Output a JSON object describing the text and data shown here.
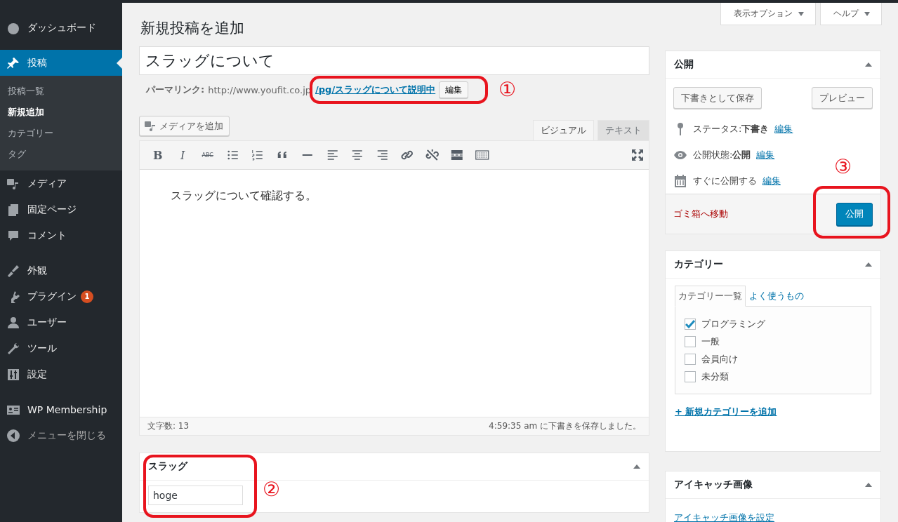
{
  "sidebar": {
    "items": [
      {
        "label": "ダッシュボード",
        "selected": false
      },
      {
        "label": "投稿",
        "selected": true,
        "children": [
          {
            "label": "投稿一覧",
            "selected": false
          },
          {
            "label": "新規追加",
            "selected": true
          },
          {
            "label": "カテゴリー",
            "selected": false
          },
          {
            "label": "タグ",
            "selected": false
          }
        ]
      },
      {
        "label": "メディア",
        "selected": false
      },
      {
        "label": "固定ページ",
        "selected": false
      },
      {
        "label": "コメント",
        "selected": false
      },
      {
        "label": "外観",
        "selected": false
      },
      {
        "label": "プラグイン",
        "selected": false,
        "badge": "1"
      },
      {
        "label": "ユーザー",
        "selected": false
      },
      {
        "label": "ツール",
        "selected": false
      },
      {
        "label": "設定",
        "selected": false
      },
      {
        "label": "WP Membership",
        "selected": false
      }
    ],
    "collapse": "メニューを閉じる"
  },
  "header_buttons": [
    "表示オプション",
    "ヘルプ"
  ],
  "page_title": "新規投稿を追加",
  "post_title": "スラッグについて",
  "permalink": {
    "label": "パーマリンク:",
    "base_url": "http://www.youfit.co.jp",
    "slug_link": "/pg/スラッグについて説明中",
    "edit_button": "編集"
  },
  "media_button": "メディアを追加",
  "editor_tabs": [
    {
      "label": "ビジュアル",
      "selected": true
    },
    {
      "label": "テキスト",
      "selected": false
    }
  ],
  "toolbar": [
    {
      "kind": "bold",
      "label": "B"
    },
    {
      "kind": "italic",
      "label": "I"
    },
    {
      "kind": "strike",
      "label": "ABC"
    },
    {
      "kind": "bullets"
    },
    {
      "kind": "numbers"
    },
    {
      "kind": "quote"
    },
    {
      "kind": "hr"
    },
    {
      "kind": "align-left"
    },
    {
      "kind": "align-center"
    },
    {
      "kind": "align-right"
    },
    {
      "kind": "link"
    },
    {
      "kind": "unlink"
    },
    {
      "kind": "more"
    },
    {
      "kind": "kitchen"
    }
  ],
  "content": "スラッグについて確認する。",
  "status_bar": {
    "word_count_label": "文字数:",
    "word_count": "13",
    "saved": "4:59:35 am に下書きを保存しました。"
  },
  "slug_box": {
    "title": "スラッグ",
    "value": "hoge"
  },
  "publish_box": {
    "title": "公開",
    "save_draft": "下書きとして保存",
    "preview": "プレビュー",
    "rows": [
      {
        "label": "ステータス:",
        "value": "下書き",
        "link": "編集"
      },
      {
        "label": "公開状態:",
        "value": "公開",
        "link": "編集"
      },
      {
        "label": "すぐに公開する",
        "link": "編集"
      }
    ],
    "trash": "ゴミ箱へ移動",
    "publish": "公開"
  },
  "category_box": {
    "title": "カテゴリー",
    "tabs": [
      {
        "label": "カテゴリー一覧",
        "selected": true
      },
      {
        "label": "よく使うもの",
        "selected": false
      }
    ],
    "items": [
      {
        "label": "プログラミング",
        "checked": true
      },
      {
        "label": "一般",
        "checked": false
      },
      {
        "label": "会員向け",
        "checked": false
      },
      {
        "label": "未分類",
        "checked": false
      }
    ],
    "add_link": "+ 新規カテゴリーを追加"
  },
  "featured_box": {
    "title": "アイキャッチ画像",
    "link": "アイキャッチ画像を設定"
  },
  "annotations": [
    {
      "label": "①"
    },
    {
      "label": "②"
    },
    {
      "label": "③"
    }
  ]
}
